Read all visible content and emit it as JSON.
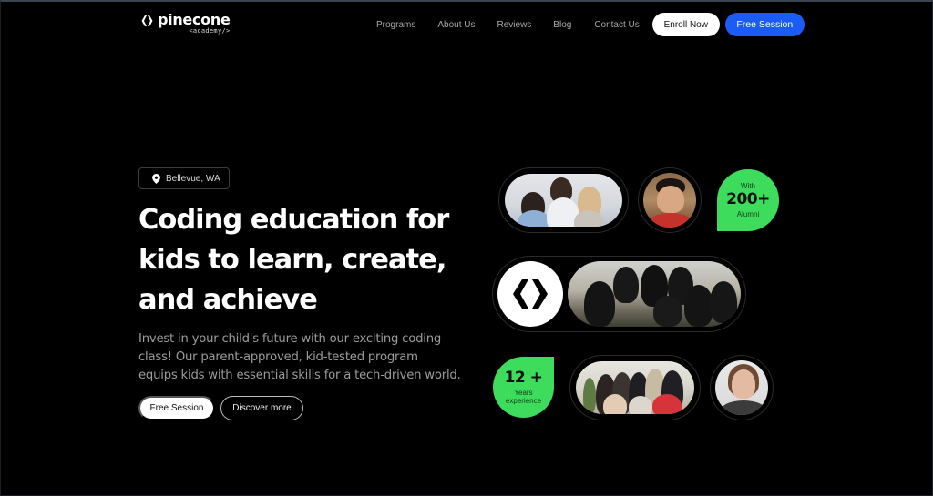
{
  "brand": {
    "name": "pinecone",
    "subtitle": "<academy/>",
    "logo_icon": "pinecone-brackets-icon"
  },
  "nav": {
    "links": [
      {
        "label": "Programs"
      },
      {
        "label": "About Us"
      },
      {
        "label": "Reviews"
      },
      {
        "label": "Blog"
      },
      {
        "label": "Contact Us"
      }
    ],
    "enroll_label": "Enroll Now",
    "free_session_label": "Free Session"
  },
  "hero": {
    "location": "Bellevue, WA",
    "location_icon": "map-pin-icon",
    "headline_lines": [
      "Coding education for",
      "kids to learn, create,",
      "and achieve"
    ],
    "lead_lines": [
      "Invest in your child's future with our exciting coding",
      "class! Our parent-approved, kid-tested program",
      "equips kids with essential skills for a tech-driven world."
    ],
    "primary_cta": "Free Session",
    "secondary_cta": "Discover more"
  },
  "stats": {
    "alumni": {
      "prefix": "With",
      "value": "200+",
      "label": "Alumni"
    },
    "years": {
      "value": "12 +",
      "label_lines": [
        "Years",
        "experience"
      ]
    }
  },
  "gallery": {
    "photos": [
      {
        "name": "family-coding-photo"
      },
      {
        "name": "student-portrait-photo"
      },
      {
        "name": "team-photo"
      },
      {
        "name": "students-group-photo"
      },
      {
        "name": "instructor-portrait-photo"
      }
    ]
  },
  "colors": {
    "background": "#000000",
    "accent_blue": "#1b5cf5",
    "accent_green": "#3ddc5c",
    "text_muted": "#9c9c9c"
  }
}
